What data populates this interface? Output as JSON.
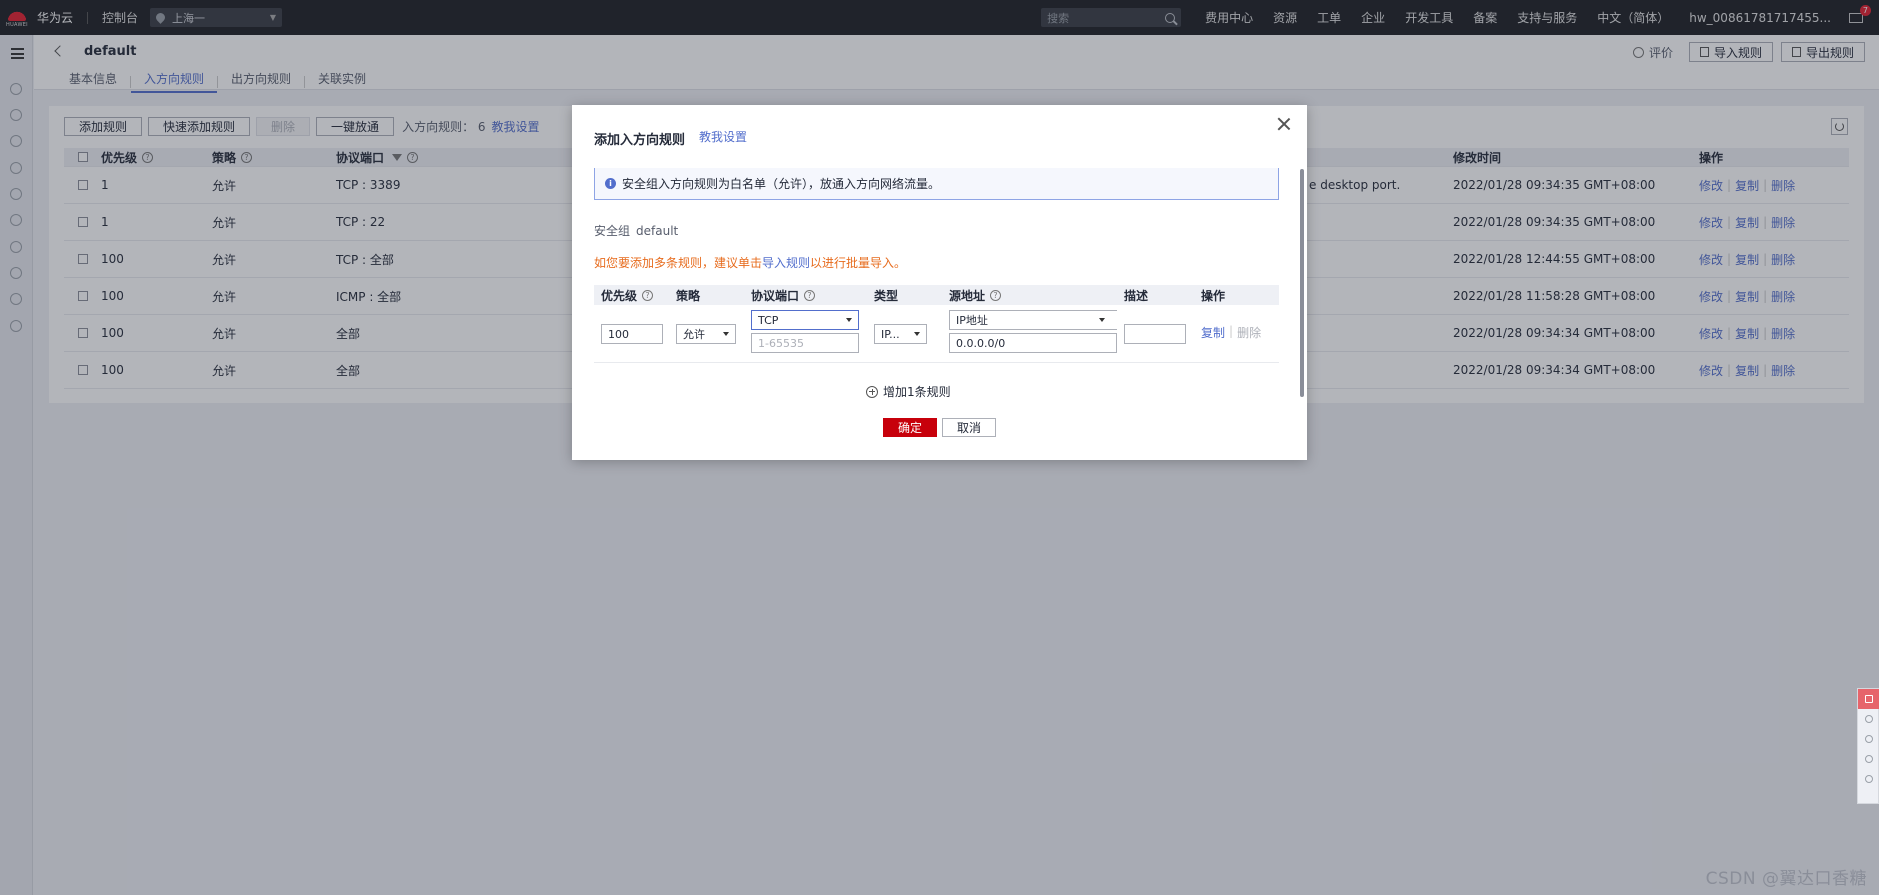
{
  "topbar": {
    "logo_text": "HUAWEI",
    "brand": "华为云",
    "console": "控制台",
    "region": "上海一",
    "search_placeholder": "搜索",
    "nav": [
      "费用中心",
      "资源",
      "工单",
      "企业",
      "开发工具",
      "备案",
      "支持与服务",
      "中文（简体）",
      "hw_00861781717455..."
    ],
    "mail_badge": "7"
  },
  "page": {
    "title": "default",
    "tabs": [
      "基本信息",
      "入方向规则",
      "出方向规则",
      "关联实例"
    ],
    "active_tab": "入方向规则",
    "rate_label": "评价",
    "import_button": "导入规则",
    "export_button": "导出规则"
  },
  "toolbar": {
    "add_rule": "添加规则",
    "quick_add": "快速添加规则",
    "delete": "删除",
    "one_click": "一键放通",
    "count_label": "入方向规则： 6",
    "help_link": "教我设置"
  },
  "table": {
    "headers": {
      "priority": "优先级",
      "policy": "策略",
      "protocol_port": "协议端口",
      "modified": "修改时间",
      "ops": "操作"
    },
    "op_labels": {
      "modify": "修改",
      "copy": "复制",
      "delete": "删除"
    },
    "rows": [
      {
        "priority": "1",
        "policy": "允许",
        "proto": "TCP : 3389",
        "desc": "e desktop port.",
        "time": "2022/01/28 09:34:35 GMT+08:00"
      },
      {
        "priority": "1",
        "policy": "允许",
        "proto": "TCP : 22",
        "desc": "",
        "time": "2022/01/28 09:34:35 GMT+08:00"
      },
      {
        "priority": "100",
        "policy": "允许",
        "proto": "TCP : 全部",
        "desc": "",
        "time": "2022/01/28 12:44:55 GMT+08:00"
      },
      {
        "priority": "100",
        "policy": "允许",
        "proto": "ICMP : 全部",
        "desc": "",
        "time": "2022/01/28 11:58:28 GMT+08:00"
      },
      {
        "priority": "100",
        "policy": "允许",
        "proto": "全部",
        "desc": "",
        "time": "2022/01/28 09:34:34 GMT+08:00"
      },
      {
        "priority": "100",
        "policy": "允许",
        "proto": "全部",
        "desc": "",
        "time": "2022/01/28 09:34:34 GMT+08:00"
      }
    ]
  },
  "modal": {
    "title": "添加入方向规则",
    "help_link": "教我设置",
    "info": "安全组入方向规则为白名单（允许），放通入方向网络流量。",
    "sg_label": "安全组",
    "sg_value": "default",
    "warn_prefix": "如您要添加多条规则，建议单击",
    "warn_link": "导入规则",
    "warn_suffix": "以进行批量导入。",
    "headers": {
      "priority": "优先级",
      "policy": "策略",
      "proto": "协议端口",
      "type": "类型",
      "source": "源地址",
      "desc": "描述",
      "ops": "操作"
    },
    "row": {
      "priority": "100",
      "policy": "允许",
      "protocol": "TCP",
      "port_placeholder": "1-65535",
      "type": "IP...",
      "source_type": "IP地址",
      "source": "0.0.0.0/0",
      "desc": "",
      "copy": "复制",
      "delete": "删除"
    },
    "add_rule": "增加1条规则",
    "ok": "确定",
    "cancel": "取消"
  },
  "watermark": "CSDN @翼达口香糖"
}
